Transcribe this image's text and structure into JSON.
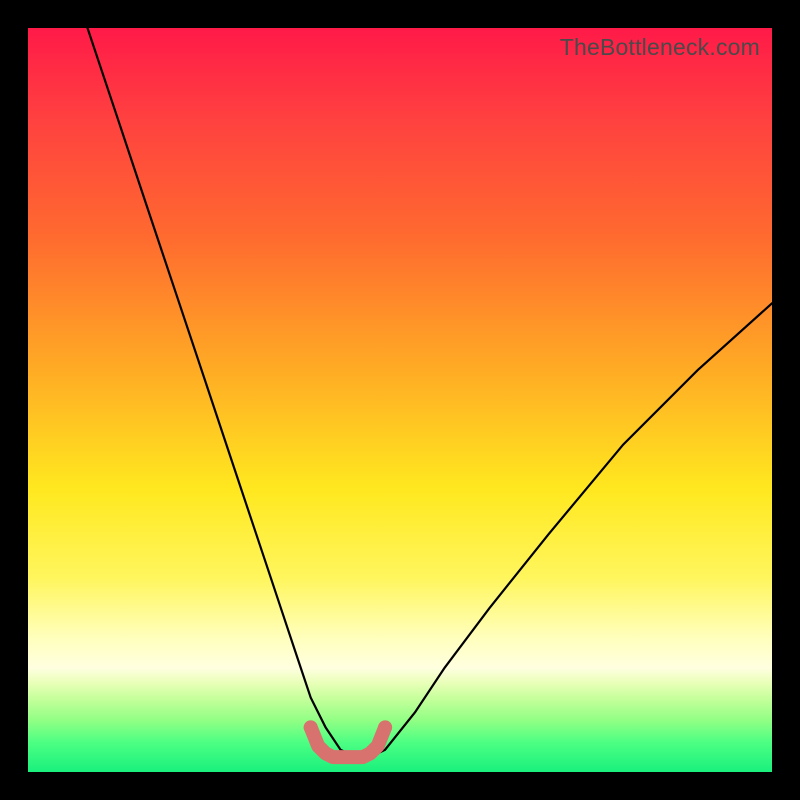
{
  "watermark": "TheBottleneck.com",
  "chart_data": {
    "type": "line",
    "title": "",
    "xlabel": "",
    "ylabel": "",
    "xlim": [
      0,
      100
    ],
    "ylim": [
      0,
      100
    ],
    "series": [
      {
        "name": "bottleneck-curve",
        "x": [
          8,
          12,
          16,
          20,
          24,
          28,
          32,
          36,
          38,
          40,
          42,
          44,
          46,
          48,
          52,
          56,
          62,
          70,
          80,
          90,
          100
        ],
        "y": [
          100,
          88,
          76,
          64,
          52,
          40,
          28,
          16,
          10,
          6,
          3,
          2,
          2,
          3,
          8,
          14,
          22,
          32,
          44,
          54,
          63
        ]
      },
      {
        "name": "bottom-marker",
        "x": [
          38,
          39,
          40,
          41,
          42,
          43,
          44,
          45,
          46,
          47,
          48
        ],
        "y": [
          6,
          3.5,
          2.5,
          2,
          2,
          2,
          2,
          2,
          2.5,
          3.5,
          6
        ]
      }
    ],
    "colors": {
      "curve": "#000000",
      "marker": "#d8726e"
    }
  }
}
